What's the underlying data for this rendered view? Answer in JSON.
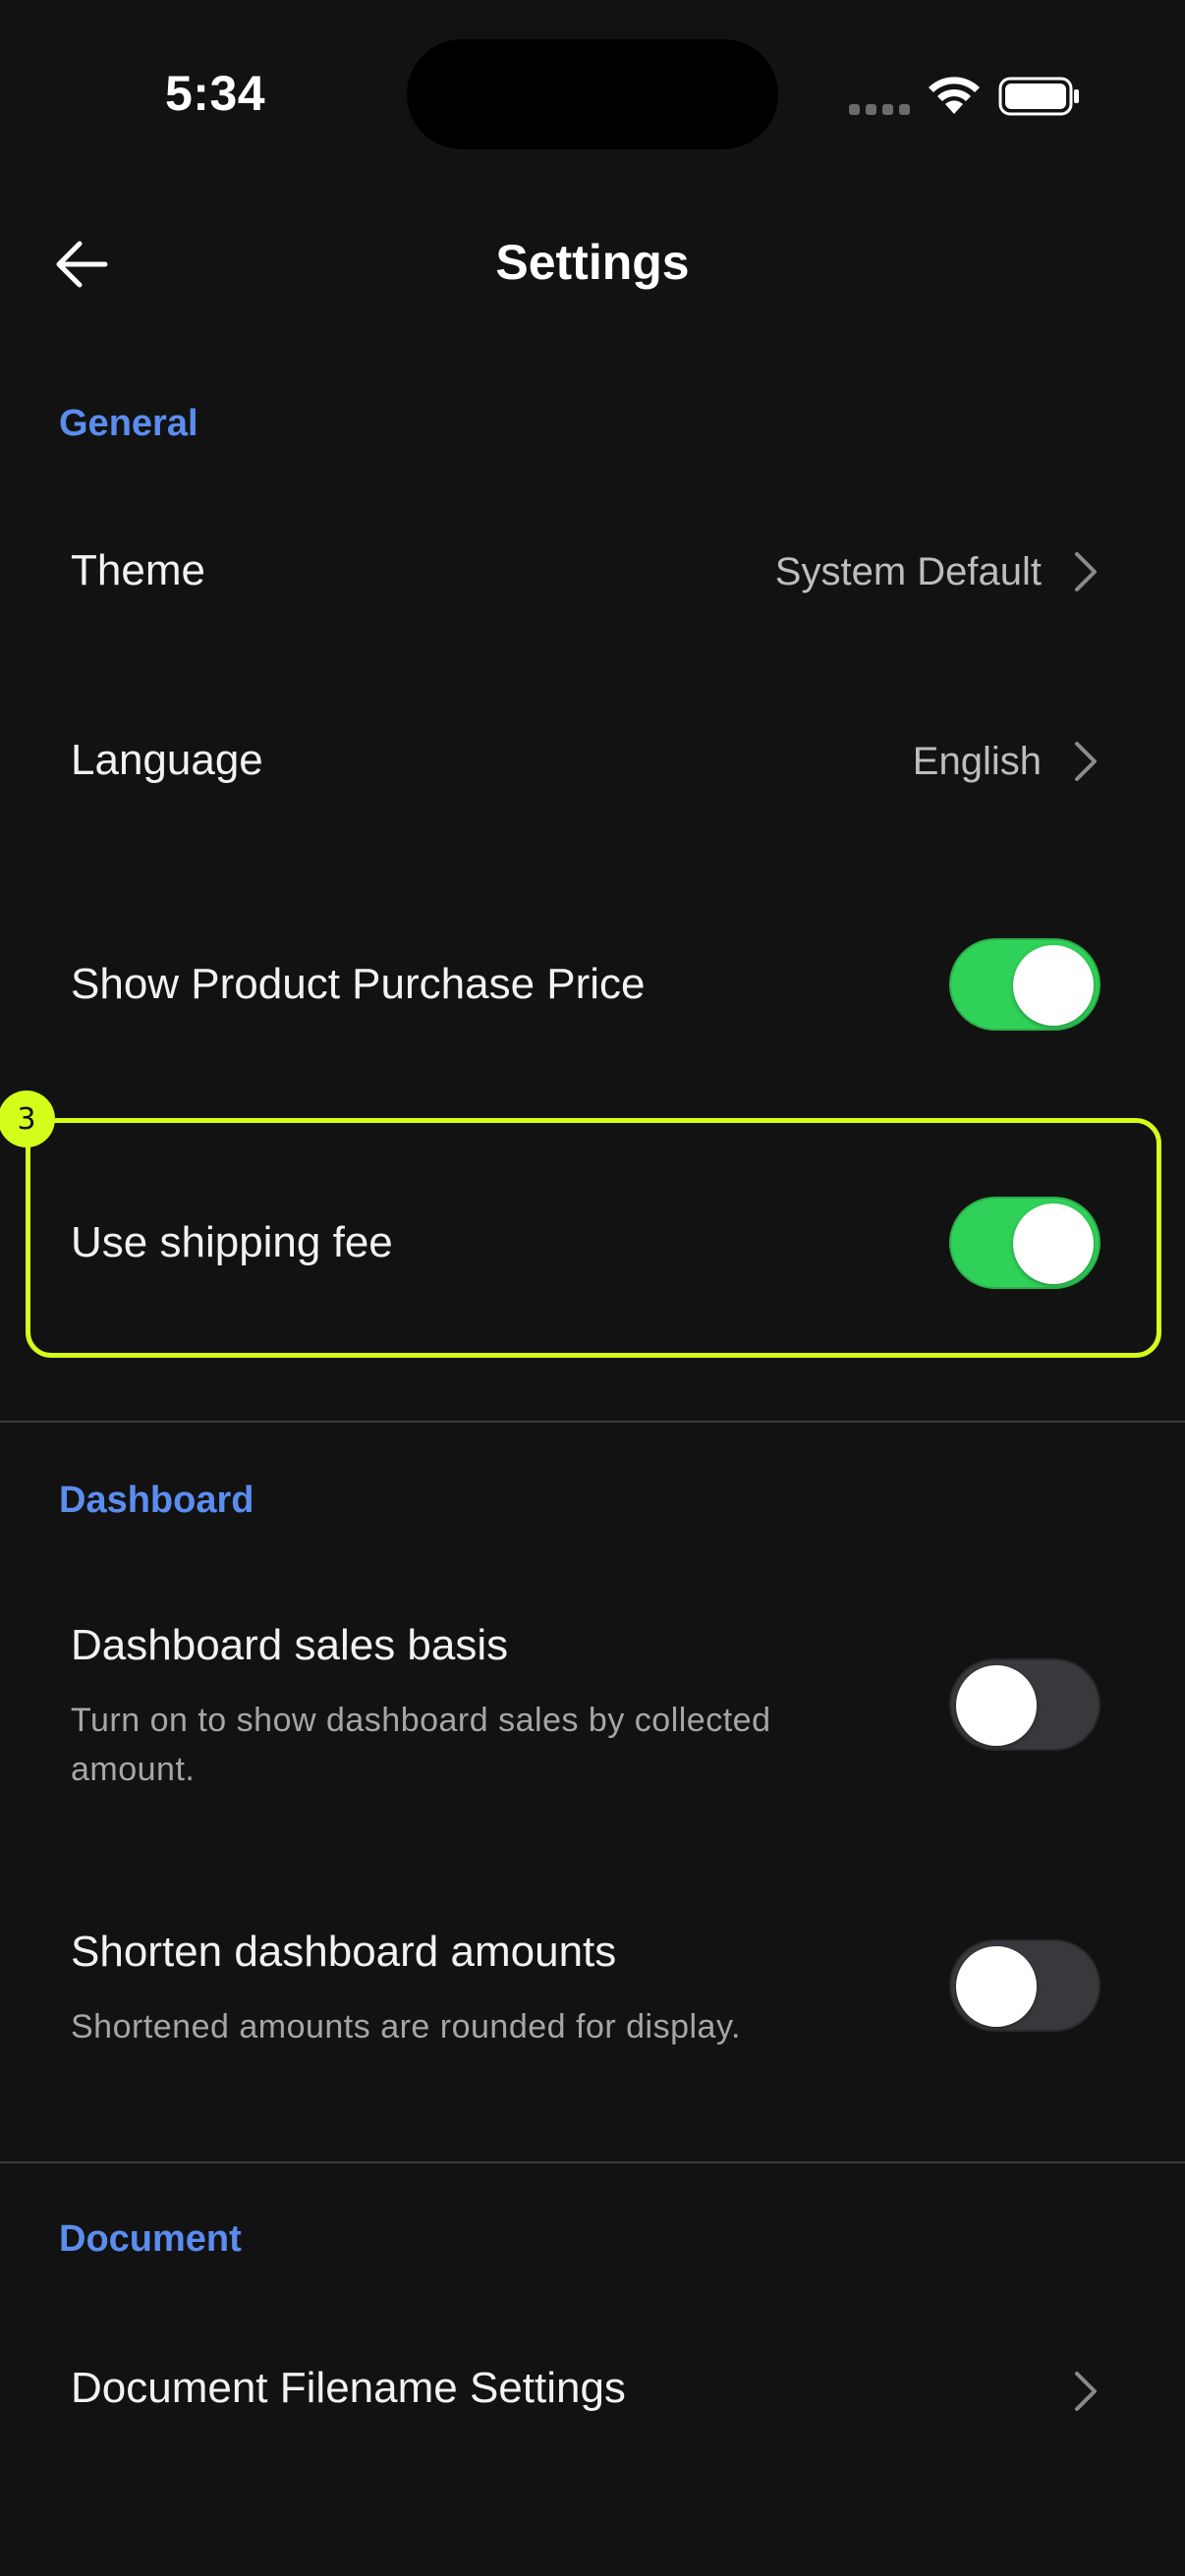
{
  "status_bar": {
    "time": "5:34"
  },
  "header": {
    "title": "Settings"
  },
  "sections": {
    "general": {
      "title": "General",
      "theme": {
        "label": "Theme",
        "value": "System Default"
      },
      "language": {
        "label": "Language",
        "value": "English"
      },
      "purchase_price": {
        "label": "Show Product Purchase Price",
        "enabled": true
      },
      "shipping_fee": {
        "label": "Use shipping fee",
        "enabled": true
      }
    },
    "dashboard": {
      "title": "Dashboard",
      "sales_basis": {
        "label": "Dashboard sales basis",
        "description": "Turn on to show dashboard sales by collected amount.",
        "enabled": false
      },
      "shorten_amounts": {
        "label": "Shorten dashboard amounts",
        "description": "Shortened amounts are rounded for display.",
        "enabled": false
      }
    },
    "document": {
      "title": "Document",
      "filename_settings": {
        "label": "Document Filename Settings"
      }
    }
  },
  "annotation": {
    "badge": "3",
    "color": "#d4ff1a"
  },
  "colors": {
    "accent": "#5b8def",
    "toggle_on": "#30d158",
    "toggle_off": "#39393d",
    "background": "#121212"
  }
}
